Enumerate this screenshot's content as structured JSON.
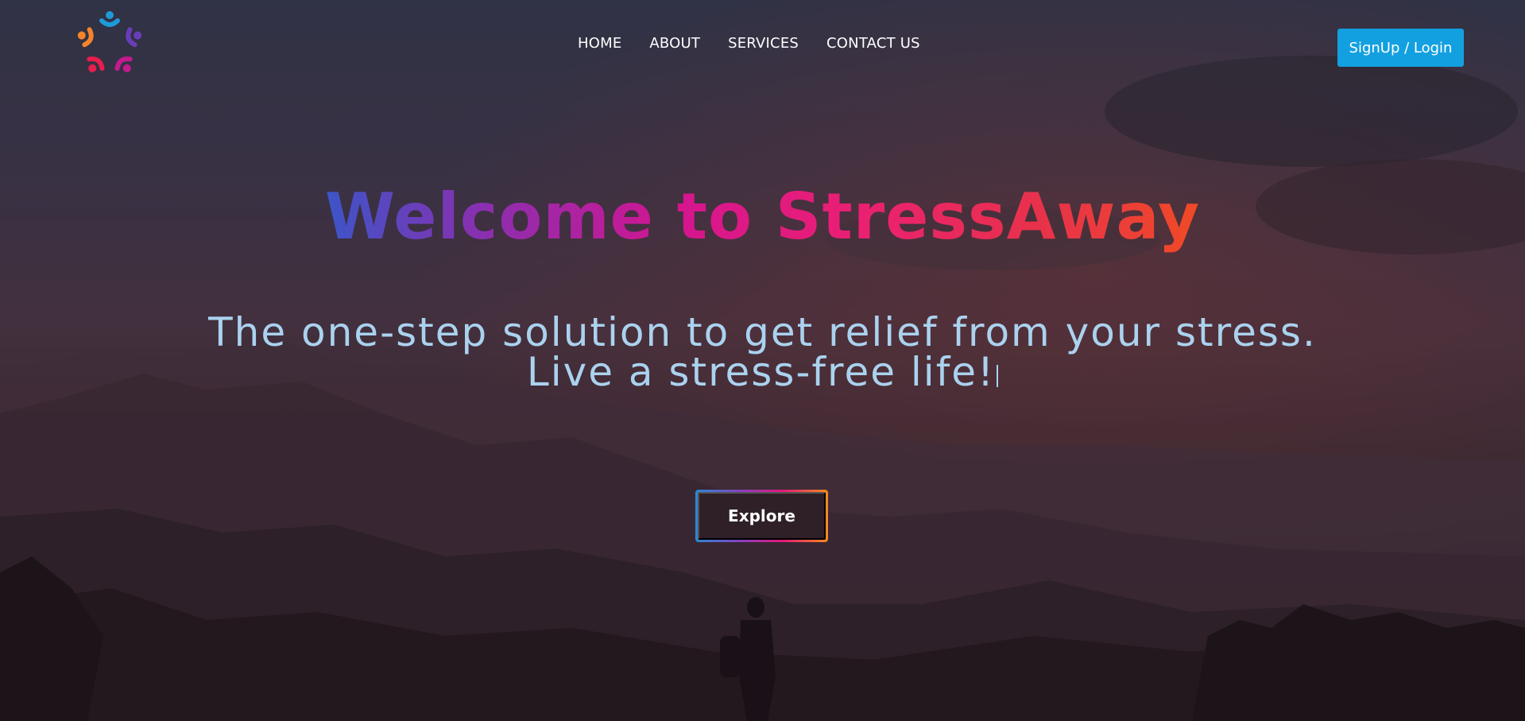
{
  "nav": {
    "items": [
      {
        "label": "HOME"
      },
      {
        "label": "ABOUT"
      },
      {
        "label": "SERVICES"
      },
      {
        "label": "CONTACT US"
      }
    ],
    "signup_label": "SignUp / Login"
  },
  "hero": {
    "title": "Welcome to StressAway",
    "subtitle": "The one-step solution to get relief from your stress. Live a stress-free life!",
    "explore_label": "Explore"
  },
  "colors": {
    "signup_bg": "#13a0e0",
    "subtitle": "#aad2ef",
    "title_gradient_start": "#3c55c8",
    "title_gradient_mid": "#d41590",
    "title_gradient_end": "#f04a26"
  },
  "icons": {
    "logo": "people-circle-logo"
  }
}
